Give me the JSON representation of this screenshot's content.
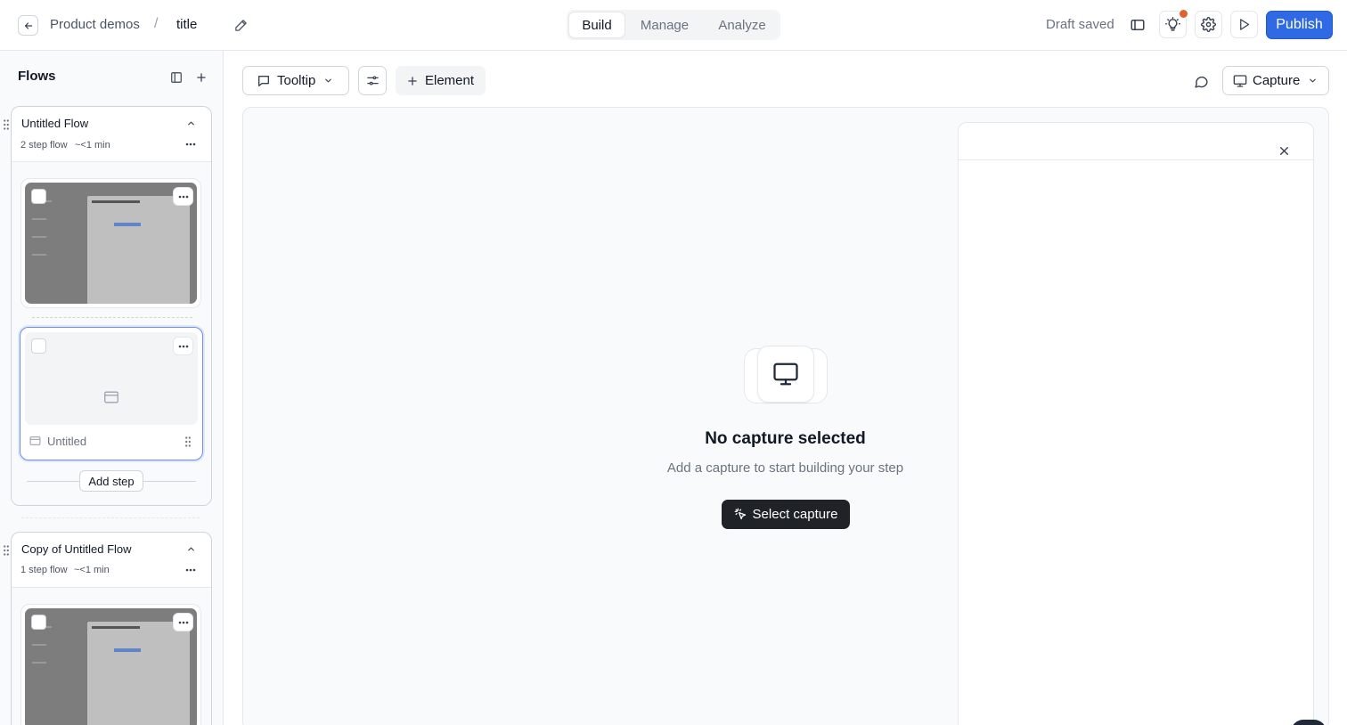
{
  "header": {
    "breadcrumb_parent": "Product demos",
    "breadcrumb_separator": "/",
    "demo_title": "title",
    "tabs": [
      {
        "label": "Build",
        "active": true
      },
      {
        "label": "Manage",
        "active": false
      },
      {
        "label": "Analyze",
        "active": false
      }
    ],
    "status": "Draft saved",
    "publish_label": "Publish",
    "notification_color": "#e0622d",
    "accent_color": "#2f6ae4"
  },
  "sidebar": {
    "title": "Flows",
    "flows": [
      {
        "name": "Untitled Flow",
        "meta_steps": "2 step flow",
        "meta_time": "~<1 min",
        "steps": [
          {
            "type": "capture",
            "thumbnail": "captured-screenshot"
          },
          {
            "type": "empty",
            "label": "Untitled",
            "selected": true
          }
        ],
        "add_step_label": "Add step"
      },
      {
        "name": "Copy of Untitled Flow",
        "meta_steps": "1 step flow",
        "meta_time": "~<1 min",
        "steps": [
          {
            "type": "capture",
            "thumbnail": "captured-screenshot"
          }
        ]
      }
    ]
  },
  "toolbar": {
    "tooltip_label": "Tooltip",
    "element_label": "Element",
    "capture_label": "Capture"
  },
  "canvas": {
    "empty_title": "No capture selected",
    "empty_subtitle": "Add a capture to start building your step",
    "select_button": "Select capture"
  }
}
